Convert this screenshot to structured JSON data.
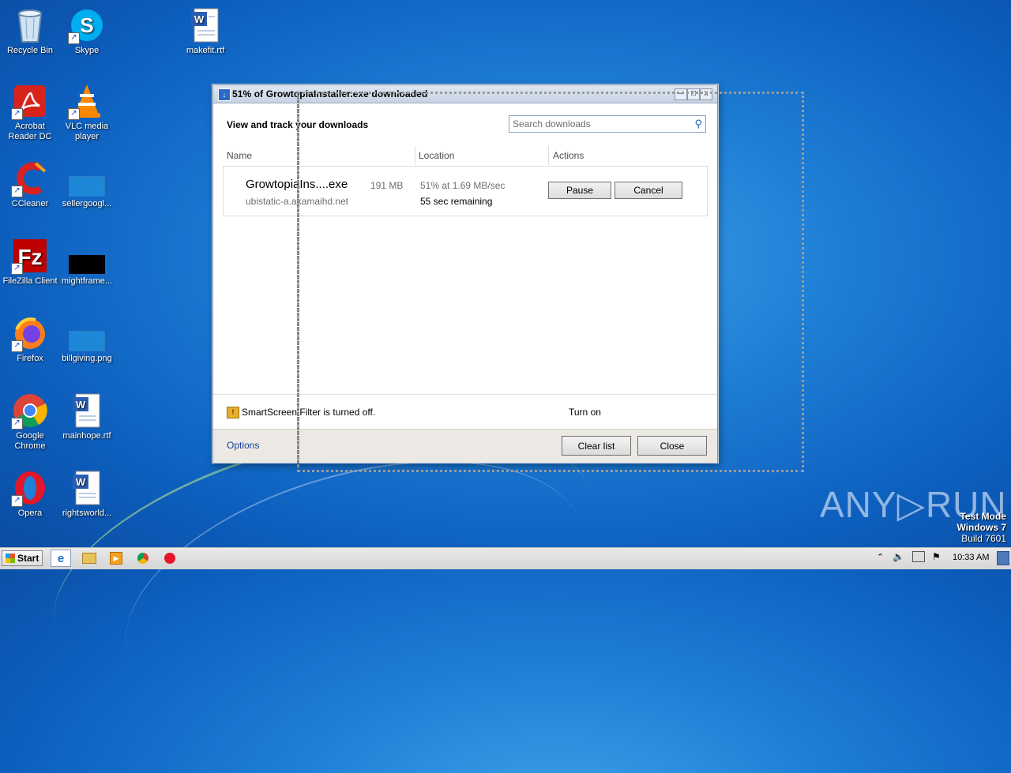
{
  "desktop": {
    "icons": [
      {
        "label": "Recycle Bin",
        "icon": "recycle-bin-icon"
      },
      {
        "label": "Skype",
        "icon": "skype-icon"
      },
      {
        "label": "makefit.rtf",
        "icon": "word-document-icon"
      },
      {
        "label": "Acrobat Reader DC",
        "icon": "acrobat-icon"
      },
      {
        "label": "VLC media player",
        "icon": "vlc-icon"
      },
      {
        "label": "CCleaner",
        "icon": "ccleaner-icon"
      },
      {
        "label": "sellergoogl...",
        "icon": "blank-file-icon"
      },
      {
        "label": "FileZilla Client",
        "icon": "filezilla-icon"
      },
      {
        "label": "mightframe...",
        "icon": "black-image-icon"
      },
      {
        "label": "Firefox",
        "icon": "firefox-icon"
      },
      {
        "label": "billgiving.png",
        "icon": "blank-file-icon"
      },
      {
        "label": "Google Chrome",
        "icon": "chrome-icon"
      },
      {
        "label": "mainhope.rtf",
        "icon": "word-document-icon"
      },
      {
        "label": "Opera",
        "icon": "opera-icon"
      },
      {
        "label": "rightsworld...",
        "icon": "word-document-icon"
      }
    ]
  },
  "dialog": {
    "title": "51% of GrowtopiaInstaller.exe downloaded",
    "heading": "View and track your downloads",
    "search_placeholder": "Search downloads",
    "columns": [
      "Name",
      "Location",
      "Actions"
    ],
    "download": {
      "filename": "GrowtopiaIns....exe",
      "size": "191 MB",
      "host": "ubistatic-a.akamaihd.net",
      "progress_text": "51% at 1.69 MB/sec",
      "remaining": "55 sec remaining",
      "progress_fraction": 0.51,
      "pause_label": "Pause",
      "cancel_label": "Cancel"
    },
    "smartscreen_text": "SmartScreen Filter is turned off.",
    "turn_on_label": "Turn on",
    "options_label": "Options",
    "clear_list_label": "Clear list",
    "close_label": "Close",
    "minimize_glyph": "–",
    "maximize_glyph": "□",
    "close_glyph": "x"
  },
  "watermark": {
    "brand": "ANY▷RUN",
    "mode": "Test Mode",
    "os": "Windows 7",
    "build": "Build 7601"
  },
  "taskbar": {
    "start_label": "Start",
    "apps": [
      "internet-explorer-icon",
      "explorer-folder-icon",
      "media-player-icon",
      "chrome-icon",
      "opera-icon"
    ],
    "clock": "10:33 AM"
  }
}
